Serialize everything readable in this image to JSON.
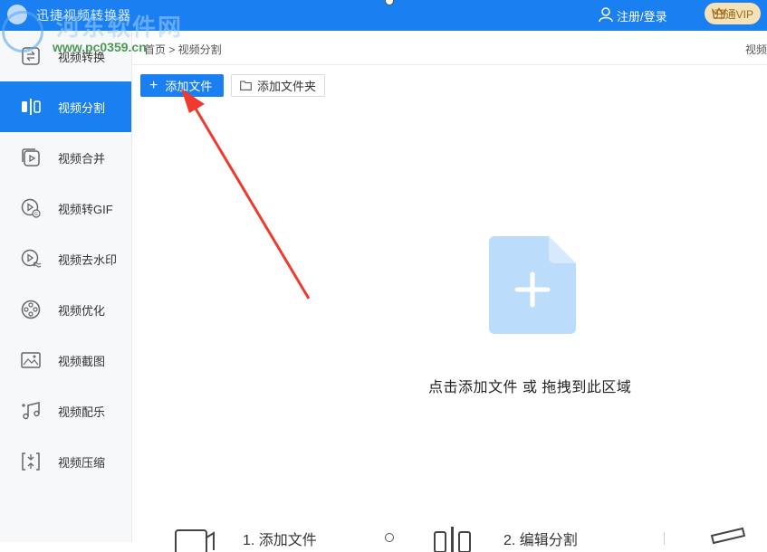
{
  "window": {
    "title": "迅捷视频转换器"
  },
  "header": {
    "login_label": "注册/登录",
    "vip_label": "开通VIP"
  },
  "watermark": {
    "cn": "河东软件网",
    "url": "www.pc0359.cn"
  },
  "breadcrumb": {
    "path": "首页 > 视频分割",
    "right_label": "视频"
  },
  "sidebar": {
    "items": [
      {
        "label": "视频转换",
        "icon": "convert-icon"
      },
      {
        "label": "视频分割",
        "icon": "split-icon",
        "active": true
      },
      {
        "label": "视频合并",
        "icon": "merge-icon"
      },
      {
        "label": "视频转GIF",
        "icon": "gif-icon"
      },
      {
        "label": "视频去水印",
        "icon": "watermark-remove-icon"
      },
      {
        "label": "视频优化",
        "icon": "optimize-icon"
      },
      {
        "label": "视频截图",
        "icon": "screenshot-icon"
      },
      {
        "label": "视频配乐",
        "icon": "music-icon"
      },
      {
        "label": "视频压缩",
        "icon": "compress-icon"
      }
    ]
  },
  "toolbar": {
    "add_file_label": "添加文件",
    "add_folder_label": "添加文件夹"
  },
  "dropzone": {
    "hint": "点击添加文件 或 拖拽到此区域"
  },
  "steps": [
    {
      "label": "1. 添加文件"
    },
    {
      "label": "2. 编辑分割"
    }
  ],
  "colors": {
    "accent": "#1a7ff0",
    "vip_bg": "#f6e2b6",
    "drop_icon": "#bcdcfb",
    "annotation_arrow": "#f03a2e"
  }
}
